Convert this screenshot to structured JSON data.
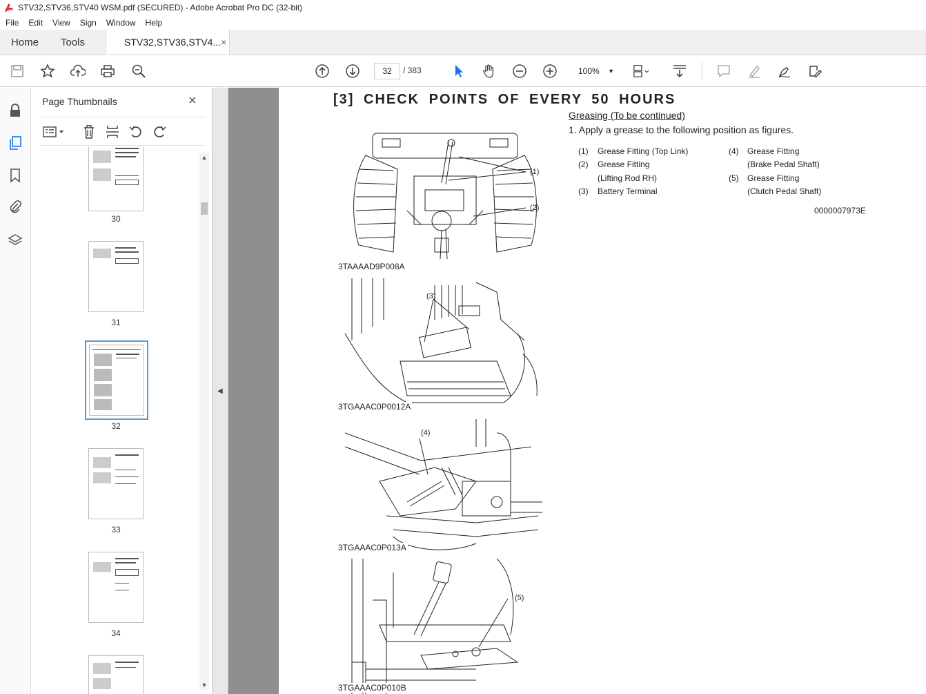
{
  "window": {
    "title": "STV32,STV36,STV40 WSM.pdf (SECURED) - Adobe Acrobat Pro DC (32-bit)"
  },
  "menu": [
    "File",
    "Edit",
    "View",
    "Sign",
    "Window",
    "Help"
  ],
  "tabs": {
    "home": "Home",
    "tools": "Tools",
    "document": "STV32,STV36,STV4...",
    "close_glyph": "×"
  },
  "toolbar": {
    "current_page": "32",
    "total_pages": "/ 383",
    "zoom": "100%",
    "icons": [
      "save-icon",
      "bookmark-star-icon",
      "cloud-upload-icon",
      "print-icon",
      "zoom-search-icon",
      "page-up-icon",
      "page-down-icon",
      "select-cursor-icon",
      "hand-icon",
      "zoom-out-icon",
      "zoom-in-icon",
      "page-display-icon",
      "scroll-mode-icon",
      "comment-icon",
      "highlight-icon",
      "sign-icon",
      "fill-sign-icon"
    ]
  },
  "thumbnails_panel": {
    "title": "Page Thumbnails",
    "close": "×",
    "pages": [
      {
        "num": "30"
      },
      {
        "num": "31"
      },
      {
        "num": "32",
        "selected": true
      },
      {
        "num": "33"
      },
      {
        "num": "34"
      },
      {
        "num": ""
      }
    ]
  },
  "document": {
    "heading": "[3]  CHECK  POINTS  OF  EVERY  50  HOURS",
    "subheading": "Greasing (To be continued)",
    "step": "1.   Apply a grease to the following position as figures.",
    "legend": [
      {
        "num": "(1)",
        "text": "Grease Fitting (Top Link)"
      },
      {
        "num": "(2)",
        "text": "Grease Fitting"
      },
      {
        "num": "",
        "text": "(Lifting Rod RH)"
      },
      {
        "num": "(3)",
        "text": "Battery Terminal"
      },
      {
        "num": "(4)",
        "text": "Grease Fitting"
      },
      {
        "num": "",
        "text": "(Brake Pedal Shaft)"
      },
      {
        "num": "(5)",
        "text": "Grease Fitting"
      },
      {
        "num": "",
        "text": "(Clutch Pedal Shaft)"
      }
    ],
    "doc_code": "0000007973E",
    "figures": [
      {
        "label": "3TAAAAD9P008A",
        "callouts": [
          "(1)",
          "(2)"
        ]
      },
      {
        "label": "3TGAAAC0P0012A",
        "callouts": [
          "(3)"
        ]
      },
      {
        "label": "3TGAAAC0P013A",
        "callouts": [
          "(4)"
        ]
      },
      {
        "label": "3TGAAAC0P010B",
        "callouts": [
          "(5)"
        ]
      }
    ]
  }
}
